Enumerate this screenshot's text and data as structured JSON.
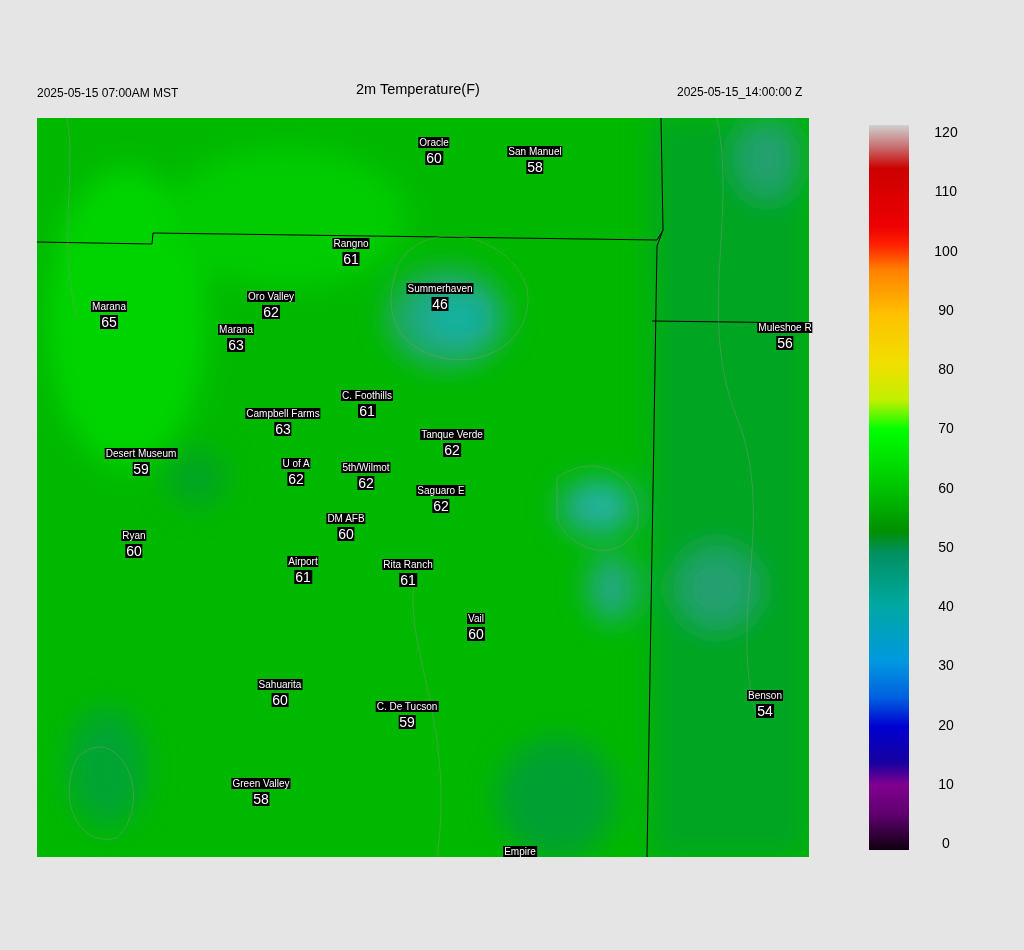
{
  "header": {
    "local_time": "2025-05-15 07:00AM MST",
    "title": "2m Temperature(F)",
    "utc_time": "2025-05-15_14:00:00 Z"
  },
  "stations": [
    {
      "name": "Oracle",
      "value": "60"
    },
    {
      "name": "San Manuel",
      "value": "58"
    },
    {
      "name": "Rangno",
      "value": "61"
    },
    {
      "name": "Summerhaven",
      "value": "46"
    },
    {
      "name": "Oro Valley",
      "value": "62"
    },
    {
      "name": "Marana",
      "value": "65"
    },
    {
      "name": "Marana",
      "value": "63"
    },
    {
      "name": "Muleshoe R",
      "value": "56"
    },
    {
      "name": "C. Foothills",
      "value": "61"
    },
    {
      "name": "Campbell Farms",
      "value": "63"
    },
    {
      "name": "Tanque Verde",
      "value": "62"
    },
    {
      "name": "Desert Museum",
      "value": "59"
    },
    {
      "name": "U of A",
      "value": "62"
    },
    {
      "name": "5th/Wilmot",
      "value": "62"
    },
    {
      "name": "Saguaro E",
      "value": "62"
    },
    {
      "name": "DM AFB",
      "value": "60"
    },
    {
      "name": "Ryan",
      "value": "60"
    },
    {
      "name": "Airport",
      "value": "61"
    },
    {
      "name": "Rita Ranch",
      "value": "61"
    },
    {
      "name": "Vail",
      "value": "60"
    },
    {
      "name": "Sahuarita",
      "value": "60"
    },
    {
      "name": "C. De Tucson",
      "value": "59"
    },
    {
      "name": "Benson",
      "value": "54"
    },
    {
      "name": "Green Valley",
      "value": "58"
    },
    {
      "name": "Empire"
    }
  ],
  "colorbar": {
    "ticks": [
      "120",
      "110",
      "100",
      "90",
      "80",
      "70",
      "60",
      "50",
      "40",
      "30",
      "20",
      "10",
      "0"
    ]
  }
}
